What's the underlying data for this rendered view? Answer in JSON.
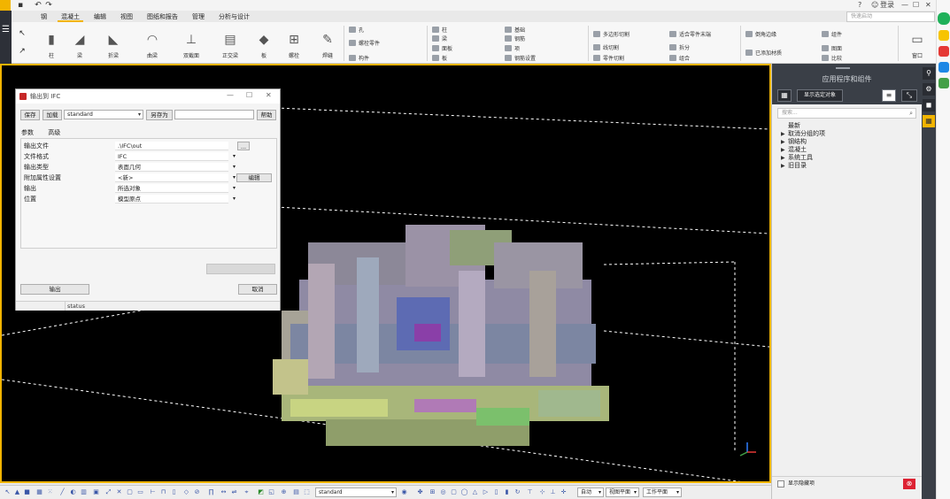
{
  "header": {
    "tabs": [
      "钢",
      "混凝土",
      "编辑",
      "视图",
      "图纸和报告",
      "管理",
      "分析与设计"
    ],
    "active_tab": 1,
    "search_placeholder": "快速启动",
    "help_label": "?",
    "user_label": "登录"
  },
  "ribbon": {
    "big_tools": [
      {
        "label": "柱",
        "icon": "column-icon"
      },
      {
        "label": "梁",
        "icon": "beam-icon"
      },
      {
        "label": "折梁",
        "icon": "polybeam-icon"
      },
      {
        "label": "曲梁",
        "icon": "curved-beam-icon"
      },
      {
        "label": "双截面",
        "icon": "twin-profile-icon"
      },
      {
        "label": "正交梁",
        "icon": "orthogonal-beam-icon"
      },
      {
        "label": "板",
        "icon": "plate-icon"
      },
      {
        "label": "螺栓",
        "icon": "bolt-icon"
      },
      {
        "label": "焊缝",
        "icon": "weld-icon"
      }
    ],
    "group1": [
      "孔",
      "螺栓零件",
      "构件"
    ],
    "group2": [
      "柱",
      "梁",
      "面板",
      "板"
    ],
    "group3": [
      "基础",
      "钢筋",
      "项",
      "钢筋设置"
    ],
    "group4": [
      "多边形切割",
      "线切割",
      "零件切割"
    ],
    "group5": [
      "适合零件末端",
      "拆分",
      "组合"
    ],
    "group6": [
      "倒角边缘",
      "已添加材质"
    ],
    "group7": [
      "组件",
      "图面",
      "比较"
    ],
    "window_label": "窗口"
  },
  "dialog": {
    "title": "输出到 IFC",
    "save": "保存",
    "load": "加载",
    "preset": "standard",
    "save_as": "另存为",
    "save_as_value": "",
    "help": "帮助",
    "tabs": [
      "参数",
      "高级"
    ],
    "params": [
      {
        "label": "输出文件",
        "value": ".\\IFC\\out",
        "type": "text"
      },
      {
        "label": "文件格式",
        "value": "IFC",
        "type": "select"
      },
      {
        "label": "输出类型",
        "value": "表面几何",
        "type": "select"
      },
      {
        "label": "附加属性设置",
        "value": "<新>",
        "type": "select"
      },
      {
        "label": "输出",
        "value": "所选对象",
        "type": "select"
      },
      {
        "label": "位置",
        "value": "模型原点",
        "type": "select"
      }
    ],
    "edit_btn": "编辑",
    "export_btn": "输出",
    "cancel_btn": "取消",
    "status": "status"
  },
  "right_panel": {
    "title": "应用程序和组件",
    "show_selected": "显示选定对象",
    "search_placeholder": "搜索...",
    "items": [
      {
        "label": "最新",
        "expandable": false
      },
      {
        "label": "取消分组的项",
        "expandable": true
      },
      {
        "label": "钢结构",
        "expandable": true
      },
      {
        "label": "混凝土",
        "expandable": true
      },
      {
        "label": "系统工具",
        "expandable": true
      },
      {
        "label": "旧目录",
        "expandable": true
      }
    ],
    "show_hidden": "显示隐藏项"
  },
  "bottombar": {
    "filter": "standard",
    "snap_mode": "自动",
    "view_plane": "视图平面",
    "work_plane": "工作平面"
  },
  "colors": {
    "accent": "#f2b400",
    "panel_dark": "#3a3f47",
    "viewport": "#000000"
  }
}
